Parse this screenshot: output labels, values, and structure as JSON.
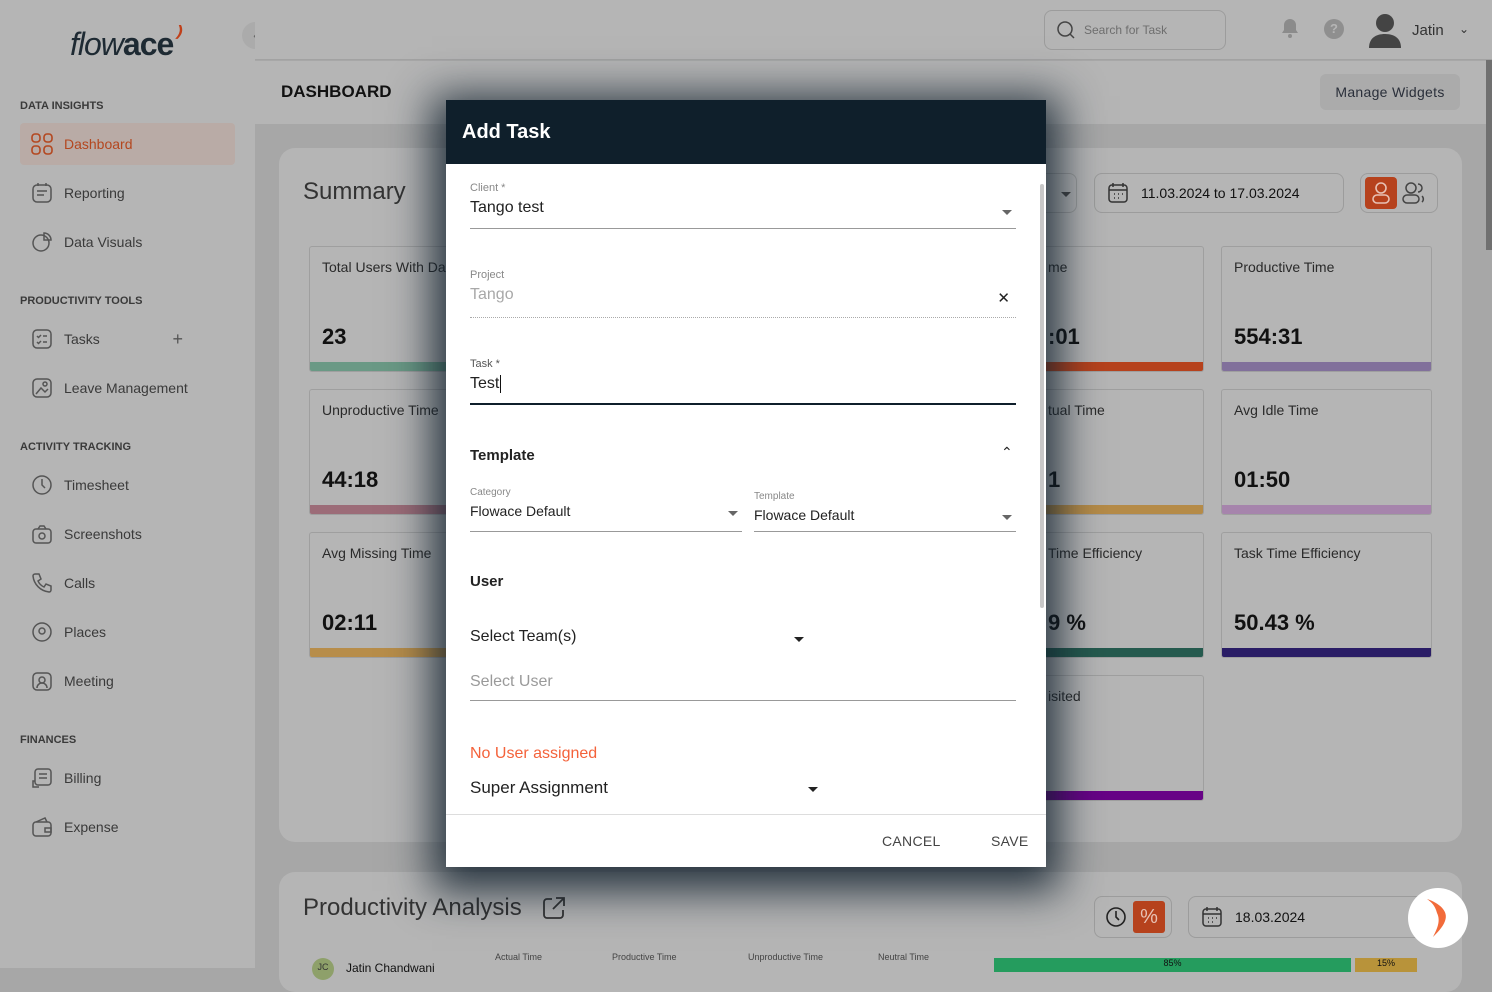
{
  "app": {
    "logo_text_a": "flow",
    "logo_text_b": "ace",
    "collapse_icon": "chevron-left-icon"
  },
  "sidebar": {
    "sections": [
      {
        "title": "DATA INSIGHTS",
        "items": [
          {
            "label": "Dashboard",
            "icon": "grid-icon",
            "active": true
          },
          {
            "label": "Reporting",
            "icon": "report-icon"
          },
          {
            "label": "Data Visuals",
            "icon": "pie-chart-icon"
          }
        ]
      },
      {
        "title": "PRODUCTIVITY TOOLS",
        "items": [
          {
            "label": "Tasks",
            "icon": "tasks-icon",
            "action": "+"
          },
          {
            "label": "Leave Management",
            "icon": "leave-icon"
          }
        ]
      },
      {
        "title": "ACTIVITY TRACKING",
        "items": [
          {
            "label": "Timesheet",
            "icon": "clock-icon"
          },
          {
            "label": "Screenshots",
            "icon": "camera-icon"
          },
          {
            "label": "Calls",
            "icon": "phone-icon"
          },
          {
            "label": "Places",
            "icon": "location-icon"
          },
          {
            "label": "Meeting",
            "icon": "meeting-icon"
          }
        ]
      },
      {
        "title": "FINANCES",
        "items": [
          {
            "label": "Billing",
            "icon": "billing-icon"
          },
          {
            "label": "Expense",
            "icon": "wallet-icon"
          }
        ]
      }
    ]
  },
  "header": {
    "search_placeholder": "Search for Task",
    "user_name": "Jatin",
    "help": "?"
  },
  "page": {
    "title": "DASHBOARD",
    "manage_widgets": "Manage Widgets"
  },
  "summary": {
    "title": "Summary",
    "date_range": "11.03.2024 to 17.03.2024",
    "cards": [
      {
        "title": "Total Users With Dat",
        "value": "23",
        "color": "#6a9985"
      },
      {
        "title": "Unproductive Time",
        "value": "44:18",
        "color": "#9c6c78"
      },
      {
        "title": "Avg Missing Time",
        "value": "02:11",
        "color": "#b78d4a"
      },
      {
        "title": "me",
        "value": ":01",
        "color": "#b6421d"
      },
      {
        "title": "tual Time",
        "value": "1",
        "color": "#b58b48"
      },
      {
        "title": "Time Efficiency",
        "value": "9 %",
        "color": "#255a4e"
      },
      {
        "title": "isited",
        "value": "",
        "color": "#670386"
      },
      {
        "title": "Productive Time",
        "value": "554:31",
        "color": "#81709b"
      },
      {
        "title": "Avg Idle Time",
        "value": "01:50",
        "color": "#a684ac"
      },
      {
        "title": "Task Time Efficiency",
        "value": "50.43 %",
        "color": "#2a1d66"
      }
    ]
  },
  "productivity": {
    "title": "Productivity Analysis",
    "date": "18.03.2024",
    "percent_symbol": "%",
    "user_partial": "Jatin Chandwani",
    "initials": "JC",
    "columns": [
      "Actual Time",
      "Productive Time",
      "Unproductive Time",
      "Neutral Time"
    ],
    "bar_labels": [
      "85%",
      "15%"
    ]
  },
  "modal": {
    "title": "Add Task",
    "client_label": "Client *",
    "client_value": "Tango test",
    "project_label": "Project",
    "project_value": "Tango",
    "task_label": "Task *",
    "task_value": "Test",
    "template_section": "Template",
    "category_label": "Category",
    "category_value": "Flowace Default",
    "template_label": "Template",
    "template_value": "Flowace Default",
    "user_section": "User",
    "teams_placeholder": "Select Team(s)",
    "user_placeholder": "Select User",
    "no_user": "No User assigned",
    "super_assignment": "Super Assignment",
    "cancel": "CANCEL",
    "save": "SAVE"
  },
  "colors": {
    "accent": "#b4471f",
    "modal_header": "#0f1f2b",
    "error": "#f4623a"
  }
}
